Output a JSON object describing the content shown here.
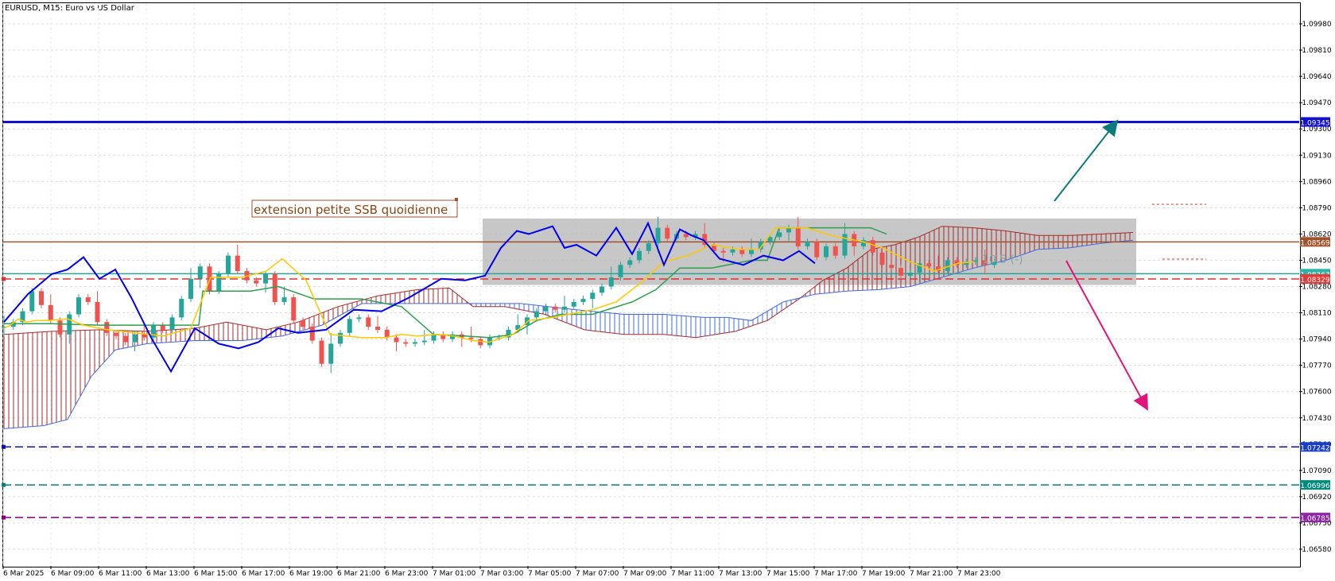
{
  "header": {
    "title": "EURUSD, M15:  Euro vs US Dollar"
  },
  "colors": {
    "bull": "#26a69a",
    "bear": "#ef5350",
    "tenkan": "#ffc800",
    "kijun": "#2e9e4f",
    "chikou": "#0000ee",
    "kumo_a": "#a52a2a",
    "kumo_b": "#4169e1",
    "resistance": "#1010d0",
    "ssb_line": "#a0522d",
    "support": "#e03030",
    "level_1": "#1010b0",
    "level_2": "#008080",
    "level_3": "#800080",
    "arrow_up": "#0e7b7b",
    "arrow_down": "#e0147a",
    "zone": "#bdbdbd"
  },
  "chart_data": {
    "type": "candlestick",
    "symbol": "EURUSD",
    "timeframe": "M15",
    "ylim": [
      1.0651,
      1.1017
    ],
    "y_ticks": [
      "1.09980",
      "1.09810",
      "1.09640",
      "1.09470",
      "1.09300",
      "1.09130",
      "1.08960",
      "1.08790",
      "1.08620",
      "1.08450",
      "1.08280",
      "1.08110",
      "1.07940",
      "1.07770",
      "1.07600",
      "1.07430",
      "1.07260",
      "1.07090",
      "1.06920",
      "1.06750",
      "1.06580"
    ],
    "x_ticks": [
      "6 Mar 2025",
      "6 Mar 09:00",
      "6 Mar 11:00",
      "6 Mar 13:00",
      "6 Mar 15:00",
      "6 Mar 17:00",
      "6 Mar 19:00",
      "6 Mar 21:00",
      "6 Mar 23:00",
      "7 Mar 01:00",
      "7 Mar 03:00",
      "7 Mar 05:00",
      "7 Mar 07:00",
      "7 Mar 09:00",
      "7 Mar 11:00",
      "7 Mar 13:00",
      "7 Mar 15:00",
      "7 Mar 17:00",
      "7 Mar 19:00",
      "7 Mar 21:00",
      "7 Mar 23:00"
    ],
    "close_path": [
      1.0802,
      1.0805,
      1.0812,
      1.0825,
      1.0816,
      1.0806,
      1.0797,
      1.081,
      1.0821,
      1.0818,
      1.0805,
      1.0798,
      1.0796,
      1.0792,
      1.0797,
      1.0795,
      1.0803,
      1.08,
      1.0808,
      1.082,
      1.0833,
      1.0841,
      1.0825,
      1.0836,
      1.0848,
      1.0838,
      1.0832,
      1.083,
      1.0836,
      1.0818,
      1.0821,
      1.0806,
      1.0802,
      1.0793,
      1.0778,
      1.0791,
      1.0798,
      1.0807,
      1.0808,
      1.0802,
      1.08,
      1.0795,
      1.0792,
      1.0791,
      1.0792,
      1.0793,
      1.0797,
      1.0794,
      1.0797,
      1.0795,
      1.0794,
      1.079,
      1.0795,
      1.0795,
      1.08,
      1.0803,
      1.0808,
      1.0812,
      1.0815,
      1.0813,
      1.0815,
      1.0818,
      1.082,
      1.0824,
      1.0828,
      1.0834,
      1.0842,
      1.0845,
      1.0851,
      1.0856,
      1.0866,
      1.0859,
      1.0862,
      1.086,
      1.0862,
      1.0855,
      1.0851,
      1.085,
      1.0852,
      1.0849,
      1.0852,
      1.0857,
      1.086,
      1.0863,
      1.0866,
      1.0854,
      1.0857,
      1.0847,
      1.0854,
      1.0848,
      1.0862,
      1.0854,
      1.0858,
      1.085,
      1.0842,
      1.084,
      1.0835,
      1.0837,
      1.0843,
      1.0841,
      1.0838,
      1.0845,
      1.0842,
      1.0844,
      1.0845,
      1.0842,
      1.0844
    ],
    "tenkan_sen": [
      [
        0,
        1.0801
      ],
      [
        8,
        1.0803
      ],
      [
        18,
        1.0807
      ],
      [
        28,
        1.0805
      ],
      [
        40,
        1.0806
      ],
      [
        55,
        1.0806
      ],
      [
        80,
        1.0807
      ],
      [
        100,
        1.0803
      ],
      [
        130,
        1.08
      ],
      [
        165,
        1.0798
      ],
      [
        200,
        1.0796
      ],
      [
        235,
        1.0801
      ],
      [
        260,
        1.0834
      ],
      [
        300,
        1.0834
      ],
      [
        330,
        1.0838
      ],
      [
        350,
        1.0846
      ],
      [
        380,
        1.0832
      ],
      [
        410,
        1.0797
      ],
      [
        430,
        1.0796
      ],
      [
        450,
        1.0795
      ],
      [
        480,
        1.0795
      ],
      [
        500,
        1.0797
      ],
      [
        520,
        1.0796
      ],
      [
        545,
        1.0797
      ],
      [
        565,
        1.0796
      ],
      [
        590,
        1.0793
      ],
      [
        610,
        1.0792
      ],
      [
        640,
        1.0797
      ],
      [
        660,
        1.0806
      ],
      [
        690,
        1.0808
      ],
      [
        710,
        1.081
      ],
      [
        740,
        1.0813
      ],
      [
        770,
        1.0818
      ],
      [
        800,
        1.083
      ],
      [
        830,
        1.0844
      ],
      [
        860,
        1.0848
      ],
      [
        890,
        1.0855
      ],
      [
        925,
        1.0852
      ],
      [
        950,
        1.0852
      ],
      [
        970,
        1.0866
      ],
      [
        1010,
        1.0866
      ],
      [
        1040,
        1.0861
      ],
      [
        1080,
        1.0857
      ],
      [
        1105,
        1.0853
      ],
      [
        1140,
        1.0844
      ],
      [
        1170,
        1.0838
      ],
      [
        1200,
        1.0843
      ],
      [
        1220,
        1.0844
      ]
    ],
    "kijun_sen": [
      [
        0,
        1.0804
      ],
      [
        30,
        1.0804
      ],
      [
        60,
        1.0804
      ],
      [
        120,
        1.0803
      ],
      [
        180,
        1.0803
      ],
      [
        245,
        1.0803
      ],
      [
        250,
        1.0825
      ],
      [
        310,
        1.0825
      ],
      [
        345,
        1.0828
      ],
      [
        390,
        1.082
      ],
      [
        450,
        1.082
      ],
      [
        500,
        1.0815
      ],
      [
        540,
        1.0797
      ],
      [
        580,
        1.0796
      ],
      [
        610,
        1.0795
      ],
      [
        640,
        1.0797
      ],
      [
        670,
        1.0806
      ],
      [
        700,
        1.081
      ],
      [
        740,
        1.081
      ],
      [
        790,
        1.0818
      ],
      [
        820,
        1.0826
      ],
      [
        850,
        1.084
      ],
      [
        890,
        1.084
      ],
      [
        940,
        1.0845
      ],
      [
        960,
        1.0845
      ],
      [
        975,
        1.0866
      ],
      [
        1000,
        1.0866
      ],
      [
        1050,
        1.0866
      ],
      [
        1090,
        1.0866
      ],
      [
        1110,
        1.0862
      ]
    ],
    "chikou_span": [
      [
        0,
        1.0805
      ],
      [
        30,
        1.0823
      ],
      [
        60,
        1.0836
      ],
      [
        80,
        1.0839
      ],
      [
        100,
        1.0847
      ],
      [
        120,
        1.0833
      ],
      [
        140,
        1.0839
      ],
      [
        160,
        1.0821
      ],
      [
        185,
        1.0795
      ],
      [
        210,
        1.0773
      ],
      [
        240,
        1.0801
      ],
      [
        270,
        1.0791
      ],
      [
        295,
        1.0788
      ],
      [
        320,
        1.0792
      ],
      [
        345,
        1.0801
      ],
      [
        370,
        1.0798
      ],
      [
        405,
        1.08
      ],
      [
        440,
        1.0813
      ],
      [
        475,
        1.0812
      ],
      [
        510,
        1.0821
      ],
      [
        550,
        1.0833
      ],
      [
        580,
        1.0832
      ],
      [
        605,
        1.0835
      ],
      [
        625,
        1.0853
      ],
      [
        645,
        1.0864
      ],
      [
        660,
        1.0862
      ],
      [
        690,
        1.0867
      ],
      [
        705,
        1.0853
      ],
      [
        720,
        1.0855
      ],
      [
        745,
        1.0848
      ],
      [
        770,
        1.0866
      ],
      [
        790,
        1.0849
      ],
      [
        810,
        1.0869
      ],
      [
        830,
        1.0842
      ],
      [
        850,
        1.0865
      ],
      [
        865,
        1.0861
      ],
      [
        880,
        1.0858
      ],
      [
        900,
        1.0846
      ],
      [
        930,
        1.0842
      ],
      [
        955,
        1.0848
      ],
      [
        980,
        1.0845
      ],
      [
        1000,
        1.0851
      ],
      [
        1020,
        1.0843
      ]
    ],
    "senkou_span_a": [
      [
        0,
        1.0797
      ],
      [
        60,
        1.0799
      ],
      [
        120,
        1.08
      ],
      [
        180,
        1.0799
      ],
      [
        240,
        1.0801
      ],
      [
        280,
        1.0805
      ],
      [
        330,
        1.08
      ],
      [
        370,
        1.0805
      ],
      [
        420,
        1.0815
      ],
      [
        470,
        1.0822
      ],
      [
        520,
        1.0826
      ],
      [
        560,
        1.0827
      ],
      [
        590,
        1.0815
      ],
      [
        630,
        1.0815
      ],
      [
        680,
        1.081
      ],
      [
        730,
        1.08
      ],
      [
        780,
        1.0797
      ],
      [
        830,
        1.0797
      ],
      [
        870,
        1.0795
      ],
      [
        920,
        1.0799
      ],
      [
        960,
        1.0806
      ],
      [
        1000,
        1.082
      ],
      [
        1030,
        1.0832
      ],
      [
        1060,
        1.084
      ],
      [
        1090,
        1.0852
      ],
      [
        1120,
        1.0855
      ],
      [
        1150,
        1.086
      ],
      [
        1180,
        1.0867
      ],
      [
        1220,
        1.0866
      ],
      [
        1260,
        1.0864
      ],
      [
        1300,
        1.0861
      ],
      [
        1340,
        1.0861
      ],
      [
        1380,
        1.0862
      ],
      [
        1420,
        1.0863
      ]
    ],
    "senkou_span_b": [
      [
        0,
        1.0736
      ],
      [
        50,
        1.0738
      ],
      [
        80,
        1.0742
      ],
      [
        110,
        1.077
      ],
      [
        140,
        1.0787
      ],
      [
        180,
        1.0791
      ],
      [
        240,
        1.0793
      ],
      [
        300,
        1.0793
      ],
      [
        350,
        1.0796
      ],
      [
        400,
        1.0803
      ],
      [
        450,
        1.0817
      ],
      [
        500,
        1.0817
      ],
      [
        560,
        1.0817
      ],
      [
        600,
        1.0817
      ],
      [
        650,
        1.0817
      ],
      [
        720,
        1.0813
      ],
      [
        780,
        1.081
      ],
      [
        830,
        1.081
      ],
      [
        880,
        1.0808
      ],
      [
        910,
        1.0808
      ],
      [
        940,
        1.0806
      ],
      [
        980,
        1.0818
      ],
      [
        1020,
        1.0823
      ],
      [
        1060,
        1.0825
      ],
      [
        1100,
        1.0826
      ],
      [
        1140,
        1.0828
      ],
      [
        1180,
        1.0834
      ],
      [
        1220,
        1.084
      ],
      [
        1260,
        1.0845
      ],
      [
        1300,
        1.0852
      ],
      [
        1340,
        1.0853
      ],
      [
        1380,
        1.0856
      ],
      [
        1420,
        1.0858
      ]
    ],
    "horizontal_levels": [
      {
        "label": "1.09345",
        "value": 1.09345,
        "style": "solid",
        "color_key": "resistance"
      },
      {
        "label": "1.08569",
        "value": 1.08569,
        "style": "solid",
        "color_key": "ssb_line"
      },
      {
        "label": "1.08363",
        "value": 1.08363,
        "style": "solid",
        "color_key": "bull"
      },
      {
        "label": "1.08329",
        "value": 1.08329,
        "style": "dashed",
        "color_key": "support"
      },
      {
        "label": "1.07242",
        "value": 1.07242,
        "style": "dashed",
        "color_key": "level_1"
      },
      {
        "label": "1.06996",
        "value": 1.06996,
        "style": "dashed",
        "color_key": "level_2"
      },
      {
        "label": "1.06785",
        "value": 1.06785,
        "style": "dashed",
        "color_key": "level_3"
      }
    ],
    "consolidation_zone": {
      "y_top": 1.0872,
      "y_bottom": 1.0829
    },
    "zone_text": "10.5 (-)",
    "annotation": "extension petite SSB quoidienne"
  }
}
